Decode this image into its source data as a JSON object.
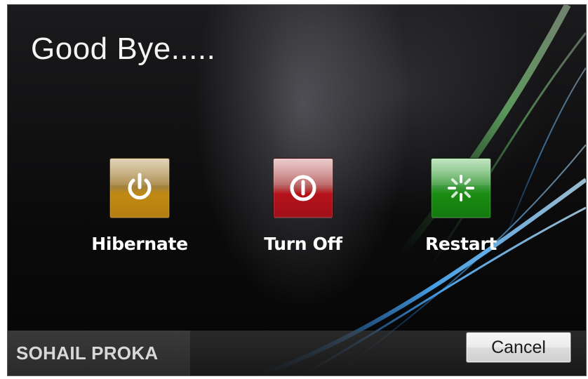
{
  "dialog": {
    "title": "Good Bye....."
  },
  "actions": [
    {
      "label": "Hibernate",
      "icon": "power-icon",
      "color": "#c08a12"
    },
    {
      "label": "Turn Off",
      "icon": "shutdown-icon",
      "color": "#b5121a"
    },
    {
      "label": "Restart",
      "icon": "restart-spinner-icon",
      "color": "#1a8c12"
    }
  ],
  "footer": {
    "user_name": "SOHAIL PROKA",
    "cancel_label": "Cancel"
  }
}
